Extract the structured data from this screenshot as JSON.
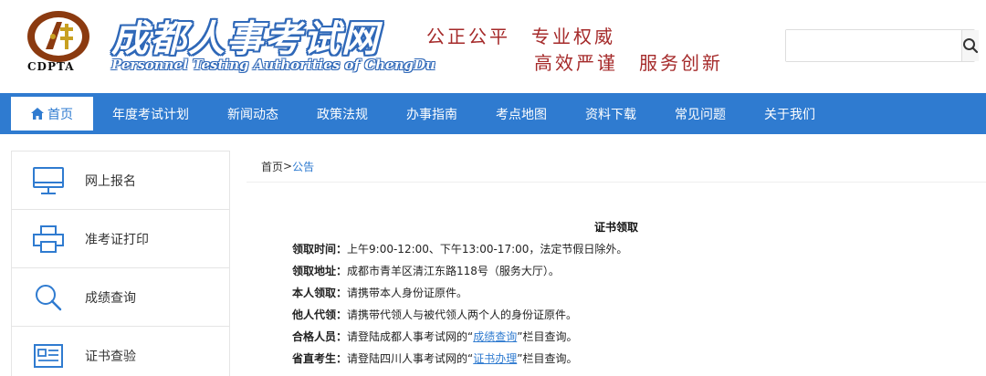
{
  "header": {
    "logo_cn": "成都人事考试网",
    "logo_en": "Personnel Testing Authorities of ChengDu",
    "logo_abbr": "CDPTA",
    "slogan_line1": "公正公平　专业权威",
    "slogan_line2": "高效严谨　服务创新",
    "search": {
      "value": "",
      "placeholder": ""
    }
  },
  "nav": {
    "items": [
      {
        "label": "首页"
      },
      {
        "label": "年度考试计划"
      },
      {
        "label": "新闻动态"
      },
      {
        "label": "政策法规"
      },
      {
        "label": "办事指南"
      },
      {
        "label": "考点地图"
      },
      {
        "label": "资料下载"
      },
      {
        "label": "常见问题"
      },
      {
        "label": "关于我们"
      }
    ]
  },
  "sidebar": {
    "items": [
      {
        "label": "网上报名",
        "icon": "monitor-icon"
      },
      {
        "label": "准考证打印",
        "icon": "printer-icon"
      },
      {
        "label": "成绩查询",
        "icon": "search-icon"
      },
      {
        "label": "证书查验",
        "icon": "certificate-icon"
      }
    ]
  },
  "breadcrumb": {
    "home": "首页",
    "sep": " > ",
    "current": "公告"
  },
  "article": {
    "title": "证书领取",
    "rows": [
      {
        "label": "领取时间",
        "text": "上午9:00-12:00、下午13:00-17:00，法定节假日除外。"
      },
      {
        "label": "领取地址",
        "text": "成都市青羊区清江东路118号（服务大厅）。"
      },
      {
        "label": "本人领取",
        "text": "请携带本人身份证原件。"
      },
      {
        "label": "他人代领",
        "text": "请携带代领人与被代领人两个人的身份证原件。"
      },
      {
        "label": "合格人员",
        "pre": "请登陆成都人事考试网的“",
        "link": "成绩查询",
        "post": "”栏目查询。"
      },
      {
        "label": "省直考生",
        "pre": "请登陆四川人事考试网的“",
        "link": "证书办理",
        "post": "”栏目查询。"
      }
    ]
  },
  "colors": {
    "nav_bg": "#2f7bd0",
    "slogan": "#a52a2a",
    "logo_blue": "#2f68b8"
  }
}
